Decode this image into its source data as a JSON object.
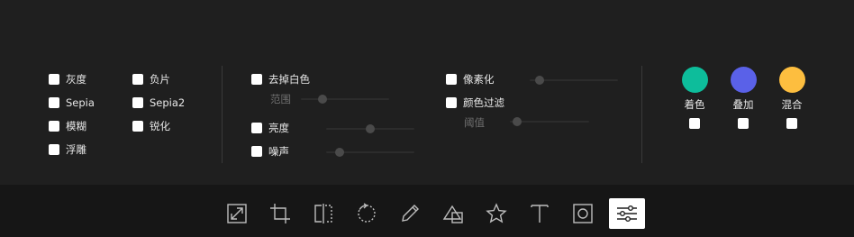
{
  "filters": {
    "col1": [
      "灰度",
      "Sepia",
      "模糊",
      "浮雕"
    ],
    "col2": [
      "负片",
      "Sepia2",
      "锐化"
    ]
  },
  "adjust": {
    "remove_white": "去掉白色",
    "range": "范围",
    "brightness": "亮度",
    "noise": "噪声",
    "pixelate": "像素化",
    "color_filter": "颜色过滤",
    "threshold": "阈值"
  },
  "sliders": {
    "range": 0.24,
    "brightness": 0.5,
    "noise": 0.15,
    "pixelate": 0.11,
    "threshold": 0.09
  },
  "colors": [
    {
      "label": "着色",
      "color": "#0dbd9b"
    },
    {
      "label": "叠加",
      "color": "#5a61e8"
    },
    {
      "label": "混合",
      "color": "#fdbe3f"
    }
  ],
  "toolbar": {
    "tools": [
      "resize-icon",
      "crop-icon",
      "flip-icon",
      "rotate-icon",
      "draw-icon",
      "shape-icon",
      "star-icon",
      "text-icon",
      "mask-icon",
      "filter-icon"
    ],
    "active": "filter-icon",
    "icon_color": "#bdbdbd",
    "active_icon_color": "#1f1f1f"
  }
}
